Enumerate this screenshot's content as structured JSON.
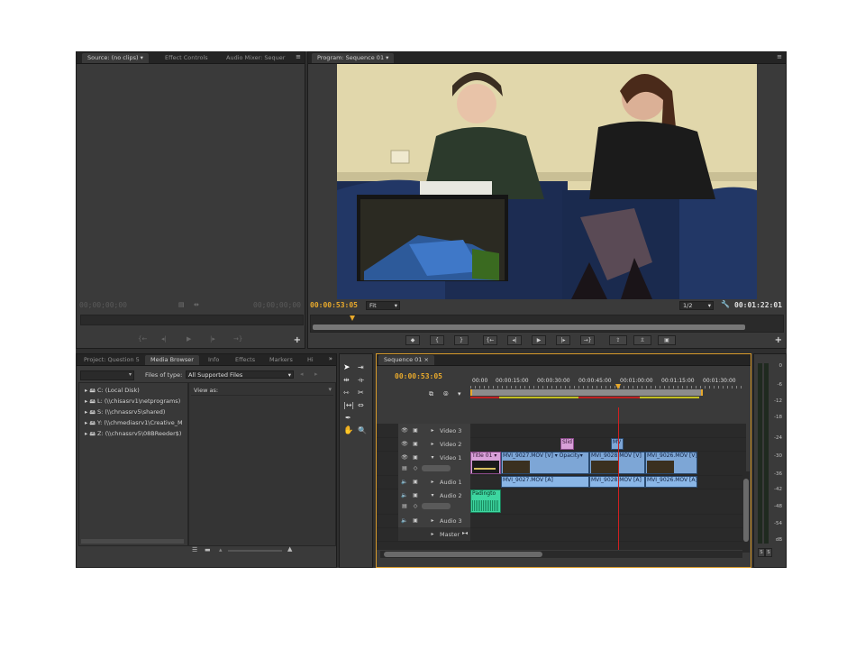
{
  "source_panel": {
    "tabs": [
      "Source: (no clips)",
      "Effect Controls",
      "Audio Mixer: Sequer"
    ],
    "timecode_left": "00;00;00;00",
    "timecode_right": "00;00;00;00"
  },
  "program_panel": {
    "tab": "Program: Sequence 01",
    "current_timecode": "00:00:53:05",
    "zoom": "Fit",
    "resolution": "1/2",
    "duration": "00:01:22:01",
    "playback": {
      "left_group": [
        "mark-in",
        "{",
        "}",
        "go-to-in",
        "step-back",
        "play",
        "step-forward",
        "go-to-out"
      ],
      "right_group": [
        "lift",
        "extract",
        "export-frame"
      ]
    }
  },
  "project_panel": {
    "tabs": [
      "Project: Question 5",
      "Media Browser",
      "Info",
      "Effects",
      "Markers",
      "Hi"
    ],
    "files_of_type_label": "Files of type:",
    "files_of_type_value": "All Supported Files",
    "view_as_label": "View as:",
    "drives": [
      "C: (Local Disk)",
      "L: (\\\\chisasrv1\\netprograms)",
      "S: (\\\\chnassrv5\\shared)",
      "Y: (\\\\chmediasrv1\\Creative_M",
      "Z: (\\\\chnassrv5\\08BReeder$)"
    ]
  },
  "timeline": {
    "tab": "Sequence 01",
    "timecode": "00:00:53:05",
    "ruler": [
      "00:00",
      "00:00:15:00",
      "00:00:30:00",
      "00:00:45:00",
      "00:01:00:00",
      "00:01:15:00",
      "00:01:30:00"
    ],
    "tracks": {
      "video3": "Video 3",
      "video2": "Video 2",
      "video1": "Video 1",
      "audio1": "Audio 1",
      "audio2": "Audio 2",
      "audio3": "Audio 3",
      "master": "Master"
    },
    "clips": {
      "v2_slide": "Slid",
      "v2_mv": "MV",
      "v1_title": "Title 01",
      "v1_c1": "MVI_9027.MOV [V]",
      "v1_c1b": "Opacity",
      "v1_c2": "MVI_9028.MOV [V]",
      "v1_c3": "MVI_9026.MOV [V]",
      "a1_c1": "MVI_9027.MOV [A]",
      "a1_c2": "MVI_9028.MOV [A]",
      "a1_c3": "MVI_9026.MOV [A]",
      "a2_c1": "Padingto"
    }
  },
  "audio_meter": {
    "labels": [
      "0",
      "-6",
      "-12",
      "-18",
      "-24",
      "-30",
      "-36",
      "-42",
      "-48",
      "-54",
      "dB"
    ],
    "solo_buttons": [
      "S",
      "S"
    ]
  },
  "colors": {
    "timecode_orange": "#e8a92c",
    "clip_video": "#7da6d6",
    "clip_audio_green": "#3dd6a0",
    "clip_title_pink": "#d9a0d9",
    "playhead_red": "#d02020"
  }
}
